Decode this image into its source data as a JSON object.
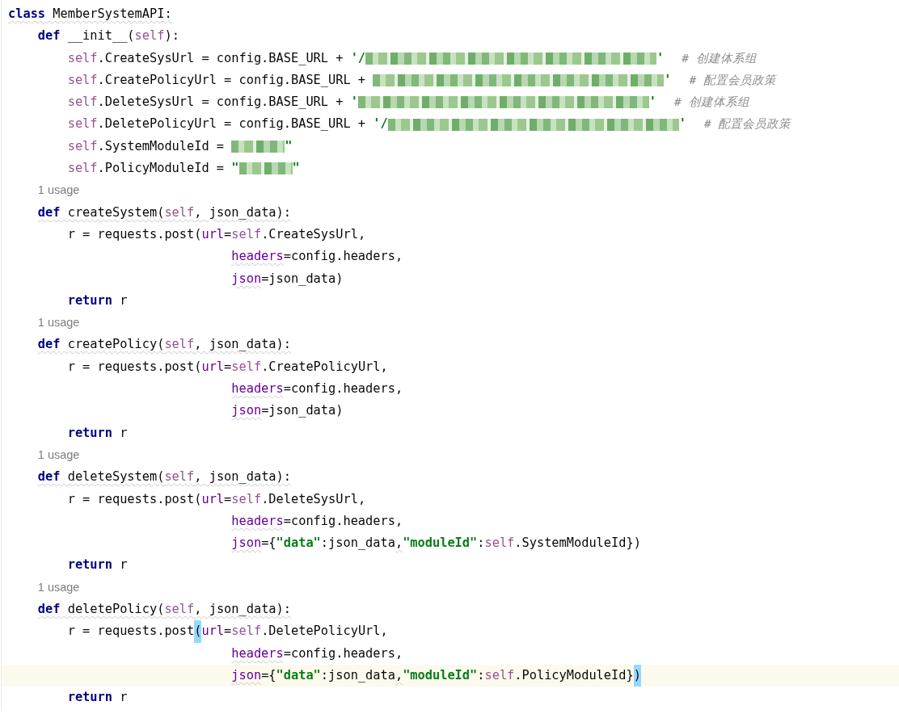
{
  "editor": {
    "lines": [
      {
        "kind": "code",
        "underline": true,
        "tokens": [
          {
            "kind": "kw",
            "text": "class"
          },
          {
            "kind": "plain",
            "text": " MemberSystemAPI:"
          }
        ],
        "children": [
          {
            "kind": "code",
            "tokens": [
              {
                "kind": "kw",
                "text": "def"
              },
              {
                "kind": "plain",
                "text": " __init__("
              },
              {
                "kind": "self",
                "text": "self"
              },
              {
                "kind": "plain",
                "text": "):"
              }
            ],
            "children": [
              {
                "kind": "code",
                "tokens": [
                  {
                    "kind": "self",
                    "text": "self"
                  },
                  {
                    "kind": "plain",
                    "text": ".CreateSysUrl = config.BASE_URL + "
                  },
                  {
                    "kind": "str",
                    "text": "'/"
                  },
                  {
                    "kind": "redacted"
                  },
                  {
                    "kind": "str",
                    "text": "'"
                  },
                  {
                    "kind": "comment",
                    "text": "# 创建体系组"
                  }
                ]
              },
              {
                "kind": "code",
                "tokens": [
                  {
                    "kind": "self",
                    "text": "self"
                  },
                  {
                    "kind": "plain",
                    "text": ".CreatePolicyUrl = config.BASE_URL + "
                  },
                  {
                    "kind": "redacted"
                  },
                  {
                    "kind": "str",
                    "text": "'"
                  },
                  {
                    "kind": "comment",
                    "text": "# 配置会员政策"
                  }
                ]
              },
              {
                "kind": "code",
                "tokens": [
                  {
                    "kind": "self",
                    "text": "self"
                  },
                  {
                    "kind": "plain",
                    "text": ".DeleteSysUrl = config.BASE_URL + "
                  },
                  {
                    "kind": "str",
                    "text": "'"
                  },
                  {
                    "kind": "redacted"
                  },
                  {
                    "kind": "str",
                    "text": "'"
                  },
                  {
                    "kind": "comment",
                    "text": "# 创建体系组"
                  }
                ]
              },
              {
                "kind": "code",
                "tokens": [
                  {
                    "kind": "self",
                    "text": "self"
                  },
                  {
                    "kind": "plain",
                    "text": ".DeletePolicyUrl = config.BASE_URL + "
                  },
                  {
                    "kind": "str",
                    "text": "'/"
                  },
                  {
                    "kind": "redacted"
                  },
                  {
                    "kind": "str",
                    "text": "'"
                  },
                  {
                    "kind": "comment",
                    "text": "# 配置会员政策"
                  }
                ]
              },
              {
                "kind": "code",
                "tokens": [
                  {
                    "kind": "self",
                    "text": "self"
                  },
                  {
                    "kind": "plain",
                    "text": ".SystemModuleId = "
                  },
                  {
                    "kind": "redacted"
                  },
                  {
                    "kind": "str",
                    "text": "\""
                  }
                ]
              },
              {
                "kind": "code",
                "tokens": [
                  {
                    "kind": "self",
                    "text": "self"
                  },
                  {
                    "kind": "plain",
                    "text": ".PolicyModuleId = "
                  },
                  {
                    "kind": "str",
                    "text": "\""
                  },
                  {
                    "kind": "redacted"
                  },
                  {
                    "kind": "str",
                    "text": "\""
                  }
                ]
              }
            ]
          },
          {
            "kind": "hint",
            "text": "1 usage"
          },
          {
            "kind": "code",
            "underline": true,
            "tokens": [
              {
                "kind": "kw",
                "text": "def"
              },
              {
                "kind": "plain",
                "text": " createSystem("
              },
              {
                "kind": "self",
                "text": "self"
              },
              {
                "kind": "plain",
                "text": ", json_data):"
              }
            ],
            "children": [
              {
                "kind": "code",
                "tokens": [
                  {
                    "kind": "plain",
                    "text": "r = requests.post("
                  },
                  {
                    "kind": "kwarg",
                    "text": "url"
                  },
                  {
                    "kind": "plain",
                    "text": "="
                  },
                  {
                    "kind": "self",
                    "text": "self"
                  },
                  {
                    "kind": "plain",
                    "text": ".CreateSysUrl,"
                  }
                ],
                "children": [
                  {
                    "kind": "continuation",
                    "tokens": [
                      {
                        "kind": "kwarg",
                        "text": "headers",
                        "underline": true
                      },
                      {
                        "kind": "plain",
                        "text": "=config.headers,"
                      }
                    ]
                  },
                  {
                    "kind": "continuation",
                    "tokens": [
                      {
                        "kind": "kwarg",
                        "text": "json",
                        "underline": true
                      },
                      {
                        "kind": "plain",
                        "text": "=json_data)"
                      }
                    ]
                  }
                ]
              },
              {
                "kind": "code",
                "tokens": [
                  {
                    "kind": "kw",
                    "text": "return"
                  },
                  {
                    "kind": "plain",
                    "text": " r"
                  }
                ]
              }
            ]
          },
          {
            "kind": "hint",
            "text": "1 usage"
          },
          {
            "kind": "code",
            "underline": true,
            "tokens": [
              {
                "kind": "kw",
                "text": "def"
              },
              {
                "kind": "plain",
                "text": " createPolicy("
              },
              {
                "kind": "self",
                "text": "self"
              },
              {
                "kind": "plain",
                "text": ", json_data):"
              }
            ],
            "children": [
              {
                "kind": "code",
                "tokens": [
                  {
                    "kind": "plain",
                    "text": "r = requests.post("
                  },
                  {
                    "kind": "kwarg",
                    "text": "url"
                  },
                  {
                    "kind": "plain",
                    "text": "="
                  },
                  {
                    "kind": "self",
                    "text": "self"
                  },
                  {
                    "kind": "plain",
                    "text": ".CreatePolicyUrl,"
                  }
                ],
                "children": [
                  {
                    "kind": "continuation",
                    "tokens": [
                      {
                        "kind": "kwarg",
                        "text": "headers",
                        "underline": true
                      },
                      {
                        "kind": "plain",
                        "text": "=config.headers,"
                      }
                    ]
                  },
                  {
                    "kind": "continuation",
                    "tokens": [
                      {
                        "kind": "kwarg",
                        "text": "json",
                        "underline": true
                      },
                      {
                        "kind": "plain",
                        "text": "=json_data)"
                      }
                    ]
                  }
                ]
              },
              {
                "kind": "code",
                "tokens": [
                  {
                    "kind": "kw",
                    "text": "return"
                  },
                  {
                    "kind": "plain",
                    "text": " r"
                  }
                ]
              }
            ]
          },
          {
            "kind": "hint",
            "text": "1 usage"
          },
          {
            "kind": "code",
            "underline": true,
            "tokens": [
              {
                "kind": "kw",
                "text": "def"
              },
              {
                "kind": "plain",
                "text": " deleteSystem("
              },
              {
                "kind": "self",
                "text": "self"
              },
              {
                "kind": "plain",
                "text": ", json_data):"
              }
            ],
            "children": [
              {
                "kind": "code",
                "tokens": [
                  {
                    "kind": "plain",
                    "text": "r = requests.post("
                  },
                  {
                    "kind": "kwarg",
                    "text": "url"
                  },
                  {
                    "kind": "plain",
                    "text": "="
                  },
                  {
                    "kind": "self",
                    "text": "self"
                  },
                  {
                    "kind": "plain",
                    "text": ".DeleteSysUrl,"
                  }
                ],
                "children": [
                  {
                    "kind": "continuation",
                    "tokens": [
                      {
                        "kind": "kwarg",
                        "text": "headers",
                        "underline": true
                      },
                      {
                        "kind": "plain",
                        "text": "=config.headers,"
                      }
                    ]
                  },
                  {
                    "kind": "continuation",
                    "tokens": [
                      {
                        "kind": "kwarg",
                        "text": "json",
                        "underline": true
                      },
                      {
                        "kind": "plain",
                        "text": "={"
                      },
                      {
                        "kind": "str",
                        "text": "\"data\""
                      },
                      {
                        "kind": "plain",
                        "text": ":json_data"
                      },
                      {
                        "kind": "plain",
                        "text": ",",
                        "underline": true
                      },
                      {
                        "kind": "str",
                        "text": "\"moduleId\""
                      },
                      {
                        "kind": "plain",
                        "text": ":"
                      },
                      {
                        "kind": "self",
                        "text": "self"
                      },
                      {
                        "kind": "plain",
                        "text": ".SystemModuleId})"
                      }
                    ]
                  }
                ]
              },
              {
                "kind": "code",
                "tokens": [
                  {
                    "kind": "kw",
                    "text": "return"
                  },
                  {
                    "kind": "plain",
                    "text": " r"
                  }
                ]
              }
            ]
          },
          {
            "kind": "hint",
            "text": "1 usage"
          },
          {
            "kind": "code",
            "underline": true,
            "tokens": [
              {
                "kind": "kw",
                "text": "def"
              },
              {
                "kind": "plain",
                "text": " deletePolicy("
              },
              {
                "kind": "self",
                "text": "self"
              },
              {
                "kind": "plain",
                "text": ", json_data):"
              }
            ],
            "children": [
              {
                "kind": "code",
                "tokens": [
                  {
                    "kind": "plain",
                    "text": "r = requests.post"
                  },
                  {
                    "kind": "plain",
                    "text": "(",
                    "matched": true
                  },
                  {
                    "kind": "kwarg",
                    "text": "url"
                  },
                  {
                    "kind": "plain",
                    "text": "="
                  },
                  {
                    "kind": "self",
                    "text": "self"
                  },
                  {
                    "kind": "plain",
                    "text": ".DeletePolicyUrl,"
                  }
                ],
                "children": [
                  {
                    "kind": "continuation",
                    "tokens": [
                      {
                        "kind": "kwarg",
                        "text": "headers",
                        "underline": true
                      },
                      {
                        "kind": "plain",
                        "text": "=config.headers,"
                      }
                    ]
                  },
                  {
                    "kind": "continuation",
                    "current": true,
                    "tokens": [
                      {
                        "kind": "kwarg",
                        "text": "json",
                        "underline": true
                      },
                      {
                        "kind": "plain",
                        "text": "={"
                      },
                      {
                        "kind": "str",
                        "text": "\"data\""
                      },
                      {
                        "kind": "plain",
                        "text": ":json_data"
                      },
                      {
                        "kind": "plain",
                        "text": ",",
                        "underline": true
                      },
                      {
                        "kind": "str",
                        "text": "\"moduleId\""
                      },
                      {
                        "kind": "plain",
                        "text": ":"
                      },
                      {
                        "kind": "self",
                        "text": "self"
                      },
                      {
                        "kind": "plain",
                        "text": ".PolicyModuleId}"
                      },
                      {
                        "kind": "plain",
                        "text": ")",
                        "matched": true
                      }
                    ]
                  }
                ]
              },
              {
                "kind": "code",
                "tokens": [
                  {
                    "kind": "kw",
                    "text": "return"
                  },
                  {
                    "kind": "plain",
                    "text": " r"
                  }
                ]
              }
            ]
          }
        ]
      }
    ]
  }
}
